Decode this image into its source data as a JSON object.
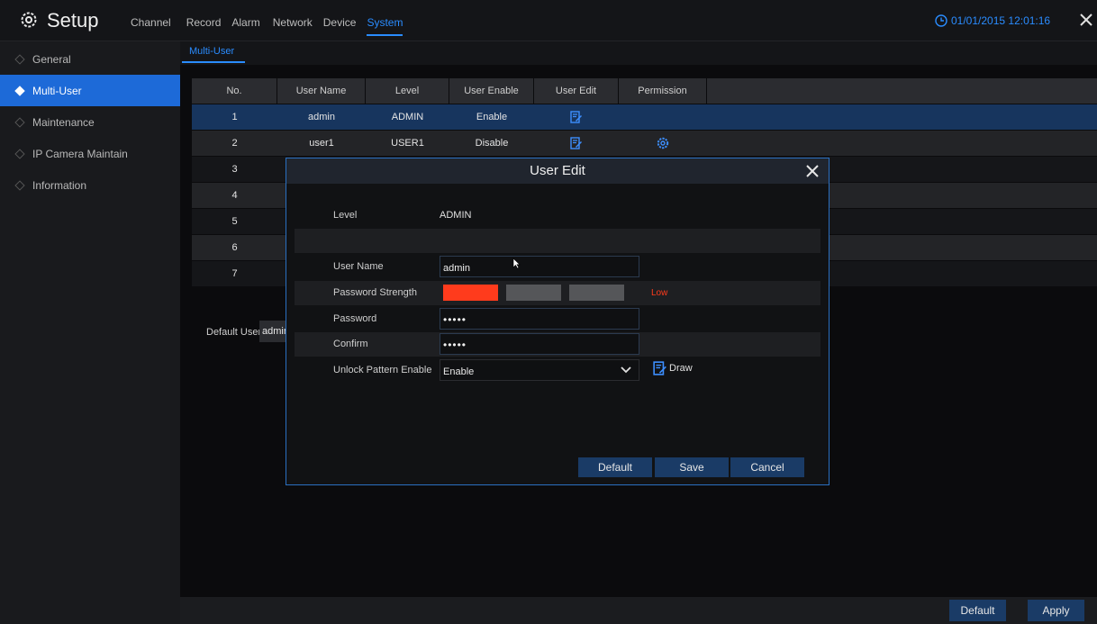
{
  "header": {
    "app_title": "Setup",
    "menu": [
      "Channel",
      "Record",
      "Alarm",
      "Network",
      "Device",
      "System"
    ],
    "active_menu": "System",
    "datetime": "01/01/2015 12:01:16"
  },
  "sidebar": {
    "items": [
      {
        "label": "General",
        "active": false
      },
      {
        "label": "Multi-User",
        "active": true
      },
      {
        "label": "Maintenance",
        "active": false
      },
      {
        "label": "IP Camera Maintain",
        "active": false
      },
      {
        "label": "Information",
        "active": false
      }
    ]
  },
  "subtab": "Multi-User",
  "table": {
    "headers": [
      "No.",
      "User Name",
      "Level",
      "User Enable",
      "User Edit",
      "Permission"
    ],
    "rows": [
      {
        "no": "1",
        "name": "admin",
        "level": "ADMIN",
        "enable": "Enable"
      },
      {
        "no": "2",
        "name": "user1",
        "level": "USER1",
        "enable": "Disable"
      },
      {
        "no": "3"
      },
      {
        "no": "4"
      },
      {
        "no": "5"
      },
      {
        "no": "6"
      },
      {
        "no": "7"
      }
    ]
  },
  "default_user": {
    "label": "Default User",
    "value": "admin"
  },
  "footer": {
    "default_label": "Default",
    "apply_label": "Apply"
  },
  "dialog": {
    "title": "User Edit",
    "level_label": "Level",
    "level_value": "ADMIN",
    "username_label": "User Name",
    "username_value": "admin",
    "strength_label": "Password Strength",
    "strength_value": "Low",
    "password_label": "Password",
    "password_value": "•••••",
    "confirm_label": "Confirm",
    "confirm_value": "•••••",
    "unlock_label": "Unlock Pattern Enable",
    "unlock_value": "Enable",
    "draw_label": "Draw",
    "buttons": {
      "default": "Default",
      "save": "Save",
      "cancel": "Cancel"
    }
  },
  "colors": {
    "accent": "#2a8cff",
    "selected_bg": "#1d6ad8",
    "strength_low": "#ff3b1c"
  }
}
